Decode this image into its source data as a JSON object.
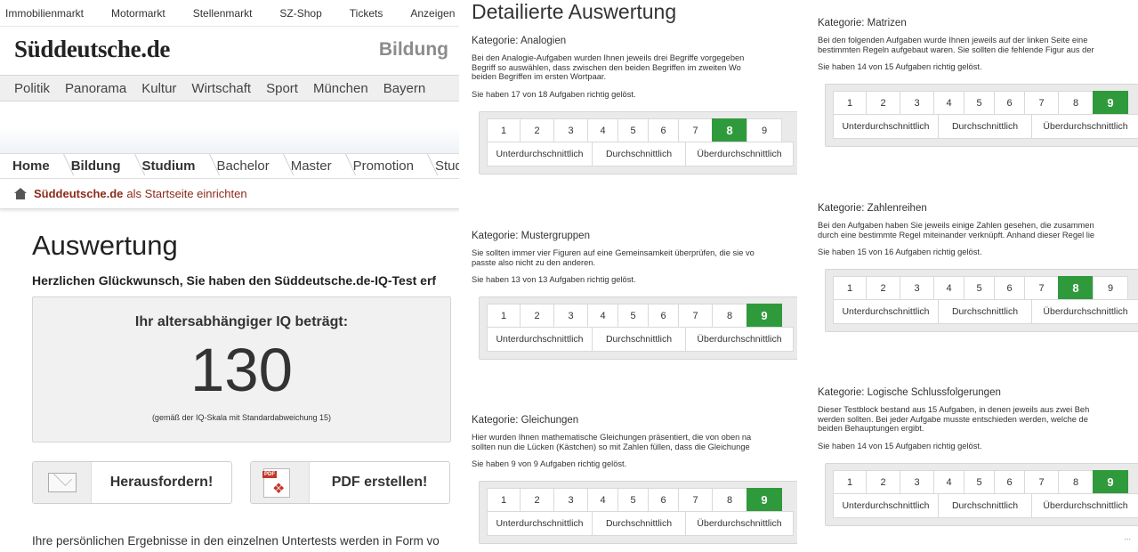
{
  "topbar": [
    "Immobilienmarkt",
    "Motormarkt",
    "Stellenmarkt",
    "SZ-Shop",
    "Tickets",
    "Anzeigen"
  ],
  "header": {
    "logo": "Süddeutsche.de",
    "section": "Bildung"
  },
  "mainnav": [
    "Politik",
    "Panorama",
    "Kultur",
    "Wirtschaft",
    "Sport",
    "München",
    "Bayern"
  ],
  "breadcrumb": [
    {
      "label": "Home",
      "bold": true
    },
    {
      "label": "Bildung",
      "bold": true
    },
    {
      "label": "Studium",
      "bold": true
    },
    {
      "label": "Bachelor",
      "bold": false
    },
    {
      "label": "Master",
      "bold": false
    },
    {
      "label": "Promotion",
      "bold": false
    },
    {
      "label": "Stud",
      "bold": false
    }
  ],
  "startpage": {
    "brand": "Süddeutsche.de",
    "rest": "als Startseite einrichten"
  },
  "result": {
    "title": "Auswertung",
    "congrats": "Herzlichen Glückwunsch, Sie haben den Süddeutsche.de-IQ-Test erf",
    "iq_label": "Ihr altersabhängiger IQ beträgt:",
    "iq_value": "130",
    "iq_note": "(gemäß der IQ-Skala mit Standardabweichung 15)"
  },
  "buttons": {
    "challenge": "Herausfordern!",
    "pdf": "PDF erstellen!",
    "pdf_tag": "PDF"
  },
  "bottom_text": "Ihre persönlichen Ergebnisse in den einzelnen Untertests werden in Form vo",
  "detail": {
    "title": "Detailierte Auswertung",
    "scale_labels": [
      "Unterdurchschnittlich",
      "Durchschnittlich",
      "Überdurchschnittlich"
    ],
    "categories": [
      {
        "title": "Kategorie: Analogien",
        "desc": "Bei den Analogie-Aufgaben wurden Ihnen jeweils drei Begriffe vorgegeben\nBegriff so auswählen, dass zwischen den beiden Begriffen im zweiten Wo\nbeiden Begriffen im ersten Wortpaar.",
        "score": "Sie haben 17 von 18 Aufgaben richtig gelöst.",
        "rating": 8
      },
      {
        "title": "Kategorie: Mustergruppen",
        "desc": "Sie sollten immer vier Figuren auf eine Gemeinsamkeit überprüfen, die sie vo\npasste also nicht zu den anderen.",
        "score": "Sie haben 13 von 13 Aufgaben richtig gelöst.",
        "rating": 9
      },
      {
        "title": "Kategorie: Gleichungen",
        "desc": "Hier wurden Ihnen mathematische Gleichungen präsentiert, die von oben na\nsollten nun die Lücken (Kästchen) so mit Zahlen füllen, dass die Gleichunge",
        "score": "Sie haben 9 von 9 Aufgaben richtig gelöst.",
        "rating": 9
      },
      {
        "title": "Kategorie: Matrizen",
        "desc": "Bei den folgenden Aufgaben wurde Ihnen jeweils auf der linken Seite eine\nbestimmten Regeln aufgebaut waren. Sie sollten die fehlende Figur aus der",
        "score": "Sie haben 14 von 15 Aufgaben richtig gelöst.",
        "rating": 9
      },
      {
        "title": "Kategorie: Zahlenreihen",
        "desc": "Bei den Aufgaben haben Sie jeweils einige Zahlen gesehen, die zusammen\ndurch eine bestimmte Regel miteinander verknüpft. Anhand dieser Regel lie",
        "score": "Sie haben 15 von 16 Aufgaben richtig gelöst.",
        "rating": 8
      },
      {
        "title": "Kategorie: Logische Schlussfolgerungen",
        "desc": "Dieser Testblock bestand aus 15 Aufgaben, in denen jeweils aus zwei Beh\nwerden sollten. Bei jeder Aufgabe musste entschieden werden, welche de\nbeiden Behauptungen ergibt.",
        "score": "Sie haben 14 von 15 Aufgaben richtig gelöst.",
        "rating": 9
      }
    ]
  },
  "colors": {
    "active_rating": "#2f9a3c",
    "brand_link": "#8b2a1a"
  },
  "more_indicator": "..."
}
